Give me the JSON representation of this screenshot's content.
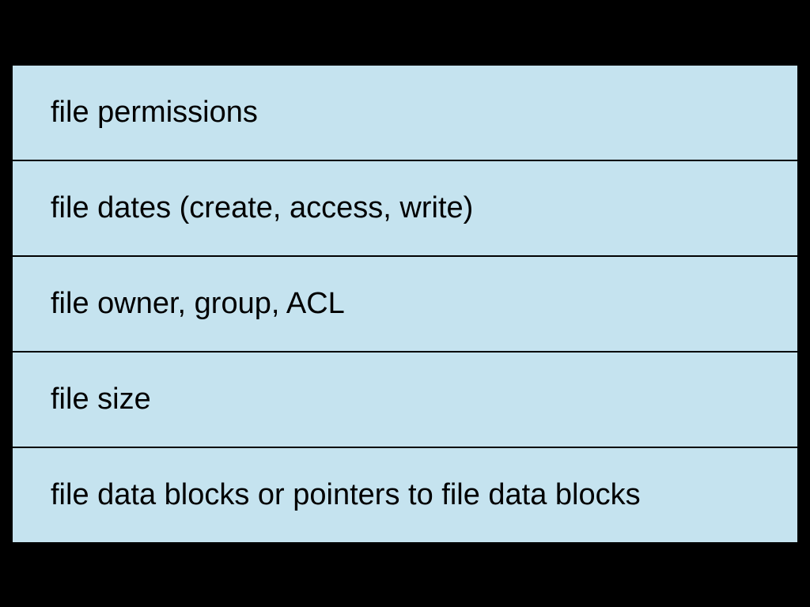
{
  "diagram": {
    "rows": [
      {
        "label": "file permissions"
      },
      {
        "label": "file dates (create, access, write)"
      },
      {
        "label": "file owner, group, ACL"
      },
      {
        "label": "file size"
      },
      {
        "label": "file data blocks or pointers to file data blocks"
      }
    ]
  }
}
